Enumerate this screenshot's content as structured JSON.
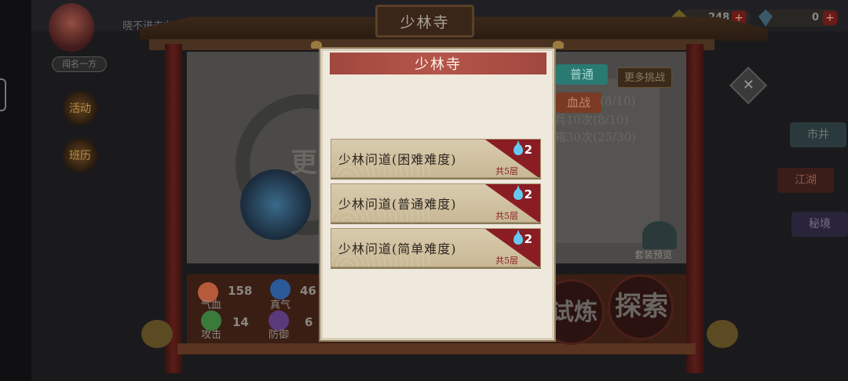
{
  "background": {
    "player_name": "晓不进去办",
    "rank_label": "闯名一方",
    "left_icons": [
      "活动",
      "班历"
    ],
    "resources": [
      {
        "icon": "gold-ingot-icon",
        "value": "248"
      },
      {
        "icon": "gem-icon",
        "value": "0"
      }
    ],
    "plus_label": "+",
    "shrine_title": "少林寺",
    "tabs": {
      "normal": "普通",
      "blood_battle": "血战",
      "more_challenge": "更多挑战"
    },
    "progress_lines": [
      "(8/10)",
      "兵10次(8/10)",
      "箱30次(25/30)"
    ],
    "side_buttons": [
      "市井",
      "江湖",
      "秘境"
    ],
    "preview_label": "套装预览",
    "more_label": "更",
    "close_label": "✕",
    "stats": [
      {
        "label": "气血",
        "value": "158",
        "color": "#b65a3a"
      },
      {
        "label": "真气",
        "value": "46",
        "color": "#2a5a9a"
      },
      {
        "label": "攻击",
        "value": "14",
        "color": "#3a7a3a"
      },
      {
        "label": "防御",
        "value": "6",
        "color": "#5a3a7a"
      }
    ],
    "action_buttons": {
      "train": "试炼",
      "explore": "探索"
    }
  },
  "modal": {
    "title": "少林寺",
    "stages": [
      {
        "name": "少林问道(困难难度)",
        "cost": "2",
        "floors": "共5层"
      },
      {
        "name": "少林问道(普通难度)",
        "cost": "2",
        "floors": "共5层"
      },
      {
        "name": "少林问道(简单难度)",
        "cost": "2",
        "floors": "共5层"
      }
    ]
  },
  "colors": {
    "modal_bg": "#efe8dc",
    "header_red": "#b5554a",
    "stage_red": "#8a1c24",
    "water_drop": "#66c8f0"
  }
}
